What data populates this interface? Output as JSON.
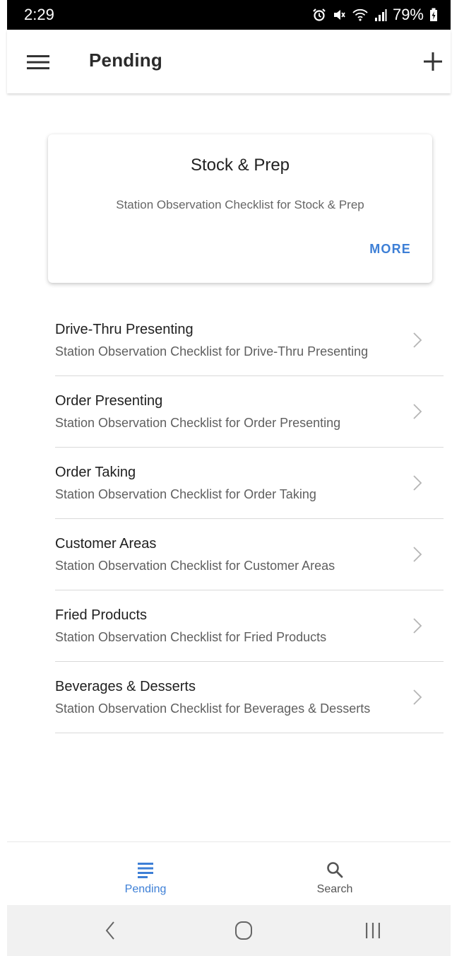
{
  "status_bar": {
    "time": "2:29",
    "battery": "79%"
  },
  "app_bar": {
    "title": "Pending",
    "menu_icon": "hamburger-menu-icon",
    "add_icon": "plus-icon"
  },
  "featured_card": {
    "title": "Stock & Prep",
    "subtitle": "Station Observation Checklist for Stock & Prep",
    "action_label": "MORE"
  },
  "checklists": [
    {
      "title": "Drive-Thru Presenting",
      "subtitle": "Station Observation Checklist for Drive-Thru Presenting"
    },
    {
      "title": "Order Presenting",
      "subtitle": "Station Observation Checklist for Order Presenting"
    },
    {
      "title": "Order Taking",
      "subtitle": "Station Observation Checklist for Order Taking"
    },
    {
      "title": "Customer Areas",
      "subtitle": "Station Observation Checklist for Customer Areas"
    },
    {
      "title": "Fried Products",
      "subtitle": "Station Observation Checklist for Fried Products"
    },
    {
      "title": "Beverages & Desserts",
      "subtitle": "Station Observation Checklist for Beverages & Desserts"
    }
  ],
  "bottom_nav": {
    "items": [
      {
        "label": "Pending",
        "icon": "list-icon",
        "active": true
      },
      {
        "label": "Search",
        "icon": "search-icon",
        "active": false
      }
    ]
  },
  "colors": {
    "accent": "#3d7fd6",
    "status_bar": "#000000",
    "system_nav": "#f1f1f1"
  }
}
